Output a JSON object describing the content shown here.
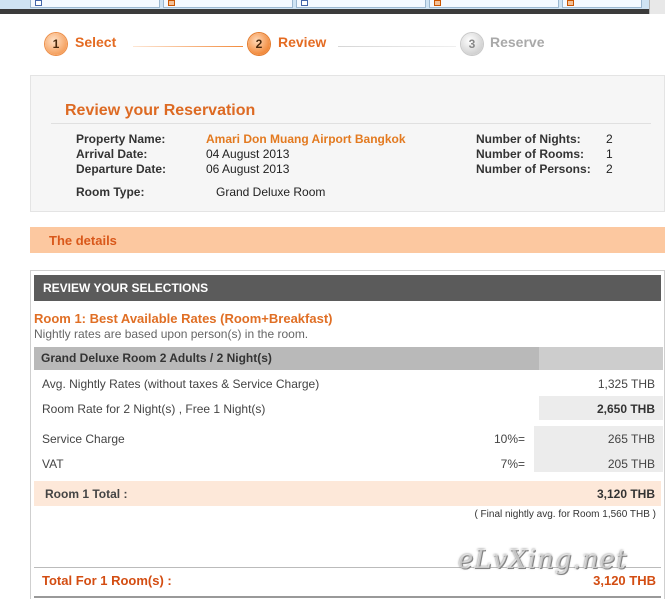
{
  "steps": [
    {
      "number": "1",
      "label": "Select"
    },
    {
      "number": "2",
      "label": "Review"
    },
    {
      "number": "3",
      "label": "Reserve"
    }
  ],
  "review": {
    "title": "Review your Reservation",
    "property_name_label": "Property Name:",
    "property_name": "Amari Don Muang Airport Bangkok",
    "arrival_label": "Arrival Date:",
    "arrival": "04 August 2013",
    "departure_label": "Departure Date:",
    "departure": "06 August 2013",
    "room_type_label": "Room Type:",
    "room_type": "Grand Deluxe Room",
    "nights_label": "Number of Nights:",
    "nights": "2",
    "rooms_label": "Number of Rooms:",
    "rooms": "1",
    "persons_label": "Number of Persons:",
    "persons": "2"
  },
  "details": {
    "title": "The details"
  },
  "selections": {
    "header": "REVIEW YOUR SELECTIONS",
    "room_title": "Room 1: Best Available Rates (Room+Breakfast)",
    "room_subtitle": "Nightly rates are based upon person(s) in the room.",
    "rate_header": "Grand Deluxe Room 2 Adults / 2 Night(s)",
    "rows": {
      "avg_label": "Avg. Nightly Rates (without taxes & Service Charge)",
      "avg_amount": "1,325 THB",
      "rate_label": "Room Rate for 2 Night(s) , Free 1 Night(s)",
      "rate_amount": "2,650 THB",
      "service_label": "Service Charge",
      "service_pct": "10%=",
      "service_amount": "265 THB",
      "vat_label": "VAT",
      "vat_pct": "7%=",
      "vat_amount": "205 THB"
    },
    "room_total_label": "Room 1 Total :",
    "room_total_amount": "3,120 THB",
    "final_avg": "( Final nightly avg. for Room  1,560 THB )",
    "grand_total_label": "Total For 1  Room(s) :",
    "grand_total_amount": "3,120 THB"
  },
  "watermark": "eLvXing.net",
  "colors": {
    "accent_orange": "#e46b22",
    "details_bar": "#fcc8a0",
    "header_grey": "#5b5b5b",
    "total_bar": "#fde8d9"
  }
}
